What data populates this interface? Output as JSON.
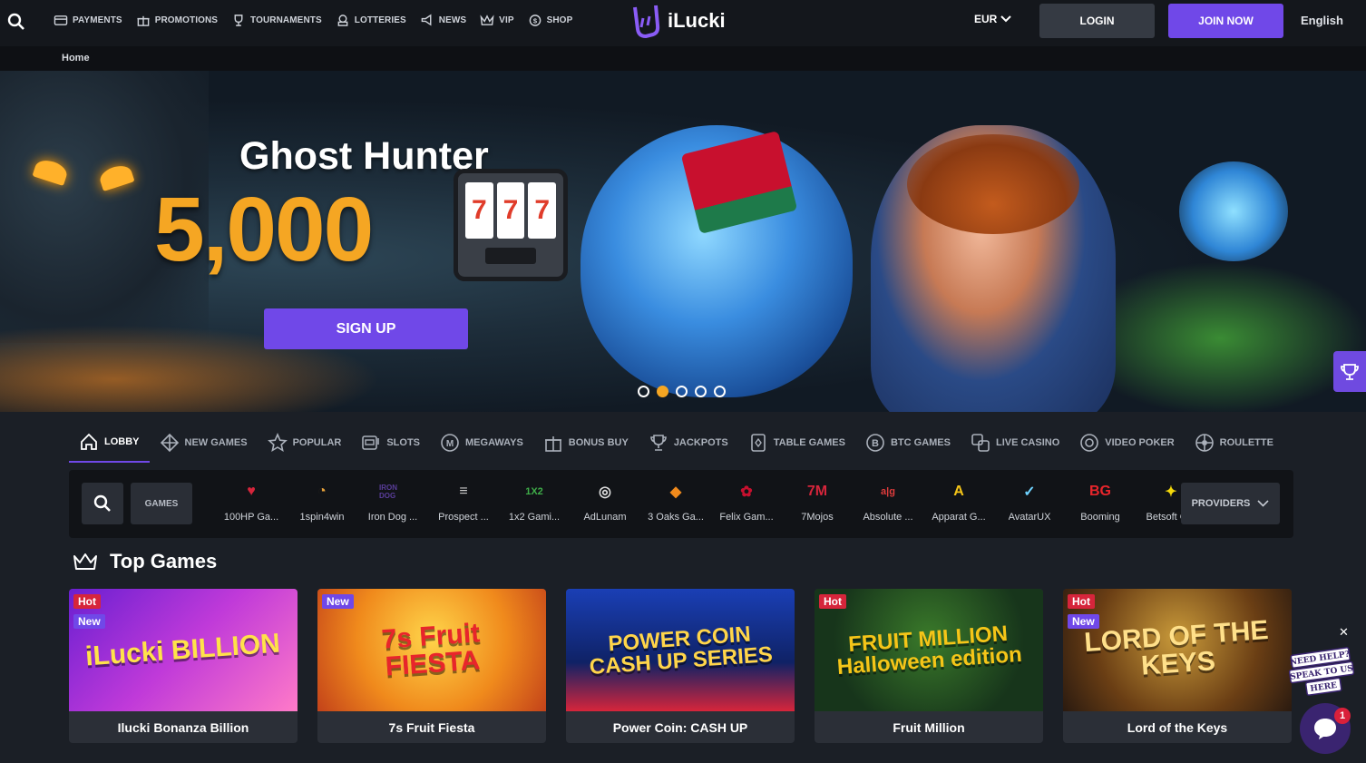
{
  "header": {
    "nav": [
      {
        "label": "PAYMENTS",
        "icon": "card-icon"
      },
      {
        "label": "PROMOTIONS",
        "icon": "gift-icon"
      },
      {
        "label": "TOURNAMENTS",
        "icon": "trophy-icon"
      },
      {
        "label": "LOTTERIES",
        "icon": "lottery-icon"
      },
      {
        "label": "NEWS",
        "icon": "megaphone-icon"
      },
      {
        "label": "VIP",
        "icon": "crown-icon"
      },
      {
        "label": "SHOP",
        "icon": "coin-icon"
      }
    ],
    "logo_text": "iLucki",
    "currency": "EUR",
    "login_label": "LOGIN",
    "join_label": "JOIN NOW",
    "language": "English"
  },
  "breadcrumb": {
    "home": "Home"
  },
  "hero": {
    "title": "Ghost Hunter",
    "amount": "5,000",
    "reels": [
      "7",
      "7",
      "7"
    ],
    "signup_label": "SIGN UP",
    "slides": 5,
    "active_slide": 2
  },
  "categories": [
    {
      "label": "LOBBY",
      "icon": "home-icon",
      "active": true
    },
    {
      "label": "NEW GAMES",
      "icon": "diamond-icon"
    },
    {
      "label": "POPULAR",
      "icon": "star-icon"
    },
    {
      "label": "SLOTS",
      "icon": "slot-machine-icon"
    },
    {
      "label": "MEGAWAYS",
      "icon": "megaways-icon"
    },
    {
      "label": "BONUS BUY",
      "icon": "gift-box-icon"
    },
    {
      "label": "JACKPOTS",
      "icon": "jackpot-trophy-icon"
    },
    {
      "label": "TABLE GAMES",
      "icon": "cards-icon"
    },
    {
      "label": "BTC GAMES",
      "icon": "bitcoin-icon"
    },
    {
      "label": "LIVE CASINO",
      "icon": "dice-icon"
    },
    {
      "label": "VIDEO POKER",
      "icon": "chip-icon"
    },
    {
      "label": "ROULETTE",
      "icon": "roulette-icon"
    }
  ],
  "providers": {
    "games_label": "GAMES",
    "button_label": "PROVIDERS",
    "items": [
      {
        "name": "100HP Ga...",
        "logo": "♥",
        "color": "#d6253b"
      },
      {
        "name": "1spin4win",
        "logo": "◔",
        "color": "#e8a23a"
      },
      {
        "name": "Iron Dog ...",
        "logo": "IRON DOG",
        "color": "#5a3d9a"
      },
      {
        "name": "Prospect ...",
        "logo": "≡",
        "color": "#c9c9c9"
      },
      {
        "name": "1x2 Gami...",
        "logo": "1X2",
        "color": "#3fae49"
      },
      {
        "name": "AdLunam",
        "logo": "◎",
        "color": "#e0e0e0"
      },
      {
        "name": "3 Oaks Ga...",
        "logo": "◆",
        "color": "#f08a1c"
      },
      {
        "name": "Felix Gam...",
        "logo": "✿",
        "color": "#c8102e"
      },
      {
        "name": "7Mojos",
        "logo": "7M",
        "color": "#d6253b"
      },
      {
        "name": "Absolute ...",
        "logo": "a|g",
        "color": "#e03c3c"
      },
      {
        "name": "Apparat G...",
        "logo": "A",
        "color": "#f5c518"
      },
      {
        "name": "AvatarUX",
        "logo": "✓",
        "color": "#6fd3ff"
      },
      {
        "name": "Booming",
        "logo": "BG",
        "color": "#e8252b"
      },
      {
        "name": "Betsoft G...",
        "logo": "✦",
        "color": "#f5d90a"
      }
    ]
  },
  "top_games": {
    "title": "Top Games",
    "items": [
      {
        "name": "Ilucki Bonanza Billion",
        "badges": [
          "Hot",
          "New"
        ],
        "art": "iLucki BILLION",
        "bg": "linear-gradient(135deg,#6a1fd1,#c03ad9 50%,#ff7ac8)",
        "fg": "#ffe24a"
      },
      {
        "name": "7s Fruit Fiesta",
        "badges": [
          "New"
        ],
        "art": "7s Fruit FIESTA",
        "bg": "radial-gradient(circle at 50% 40%,#ffd54a,#f08a1c 55%,#c3421a)",
        "fg": "#e8252b"
      },
      {
        "name": "Power Coin: CASH UP",
        "badges": [],
        "art": "POWER COIN CASH UP SERIES",
        "bg": "linear-gradient(180deg,#1a3fb5,#0f2266 60%,#d6253b)",
        "fg": "#ffd54a"
      },
      {
        "name": "Fruit Million",
        "badges": [
          "Hot"
        ],
        "art": "FRUIT MILLION Halloween edition",
        "bg": "radial-gradient(circle at 50% 40%,#3a7a2a,#17351b 70%)",
        "fg": "#f5c518"
      },
      {
        "name": "Lord of the Keys",
        "badges": [
          "Hot",
          "New"
        ],
        "art": "LORD OF THE KEYS",
        "bg": "radial-gradient(circle at 50% 40%,#c99a3a,#6a3e14 60%,#2a1a10)",
        "fg": "#ffe08a"
      }
    ]
  },
  "help": {
    "text": "NEED HELP? SPEAK TO US HERE",
    "chat_count": "1"
  },
  "colors": {
    "accent": "#7048e8",
    "gold": "#f5a623",
    "hot": "#d6253b"
  }
}
